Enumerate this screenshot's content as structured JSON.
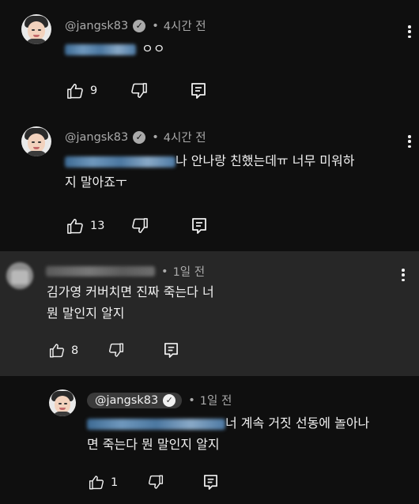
{
  "comments": [
    {
      "handle": "@jangsk83",
      "time": "4시간 전",
      "text_visible": "ㅇㅇ",
      "likes": "9"
    },
    {
      "handle": "@jangsk83",
      "time": "4시간 전",
      "text_line1": "나 안나랑 친했는데ㅠ 너무 미워하",
      "text_line2": "지 말아죠ㅜ",
      "likes": "13"
    },
    {
      "time": "1일 전",
      "text_line1": "김가영 커버치면 진짜 죽는다 너",
      "text_line2": "뭔 말인지 알지",
      "likes": "8"
    },
    {
      "handle": "@jangsk83",
      "time": "1일 전",
      "text_line1": "너 계속 거짓 선동에 놀아나",
      "text_line2": "면 죽는다 뭔 말인지 알지",
      "likes": "1"
    }
  ],
  "icons": {
    "verified": "check-icon",
    "like": "thumbs-up-icon",
    "dislike": "thumbs-down-icon",
    "reply": "reply-icon",
    "more": "kebab-icon"
  },
  "colors": {
    "background": "#0f0f0f",
    "highlight_background": "#272727",
    "text": "#f1f1f1",
    "secondary_text": "#aaaaaa"
  }
}
